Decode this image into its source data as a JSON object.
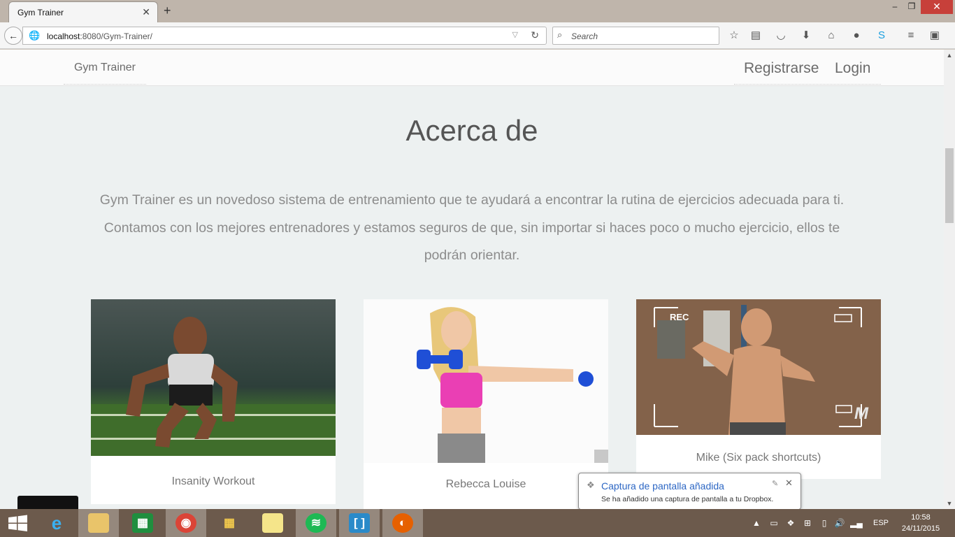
{
  "browser": {
    "tab_title": "Gym Trainer",
    "tab_close": "✕",
    "new_tab": "+",
    "window_controls": {
      "minimize": "–",
      "maximize": "❐",
      "close": "✕"
    },
    "url_host": "localhost",
    "url_rest": ":8080/Gym-Trainer/",
    "search_placeholder": "Search",
    "toolbar_icons": [
      "star-icon",
      "reading-list-icon",
      "pocket-icon",
      "download-icon",
      "home-icon",
      "chat-icon",
      "skype-icon",
      "menu-icon",
      "extension-icon"
    ]
  },
  "site": {
    "brand": "Gym Trainer",
    "nav": {
      "register": "Registrarse",
      "login": "Login"
    },
    "heading": "Acerca de",
    "intro_lines": [
      "Gym Trainer es un novedoso sistema de entrenamiento que te ayudará a encontrar la rutina de ejercicios adecuada para ti.",
      "Contamos con los mejores entrenadores y estamos seguros de que, sin importar si haces poco o mucho ejercicio, ellos te",
      "podrán orientar."
    ],
    "trainers": [
      {
        "caption": "Insanity Workout"
      },
      {
        "caption": "Rebecca Louise"
      },
      {
        "caption": "Mike (Six pack shortcuts)",
        "overlay_rec": "REC",
        "overlay_logo": "M"
      }
    ]
  },
  "notification": {
    "title": "Captura de pantalla añadida",
    "text": "Se ha añadido una captura de pantalla a tu Dropbox.",
    "close": "✕"
  },
  "taskbar": {
    "apps": [
      "Internet Explorer",
      "File Explorer",
      "Store",
      "Chrome",
      "Apps",
      "Sticky Notes",
      "Spotify",
      "Brackets",
      "Firefox"
    ],
    "language": "ESP",
    "time": "10:58",
    "date": "24/11/2015"
  },
  "colors": {
    "accent_link": "#2d67c4",
    "close_red": "#c7403a",
    "page_bg": "#edf1f1"
  }
}
